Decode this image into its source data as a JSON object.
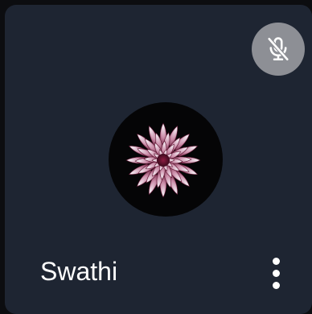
{
  "participant": {
    "name": "Swathi",
    "microphone_icon": "mic-off-icon",
    "avatar_image": "dahlia-flower",
    "menu_icon": "more-vert-icon"
  },
  "colors": {
    "tile_background": "#1e2532",
    "mute_badge": "#8d8f95",
    "name_text": "#ffffff"
  }
}
